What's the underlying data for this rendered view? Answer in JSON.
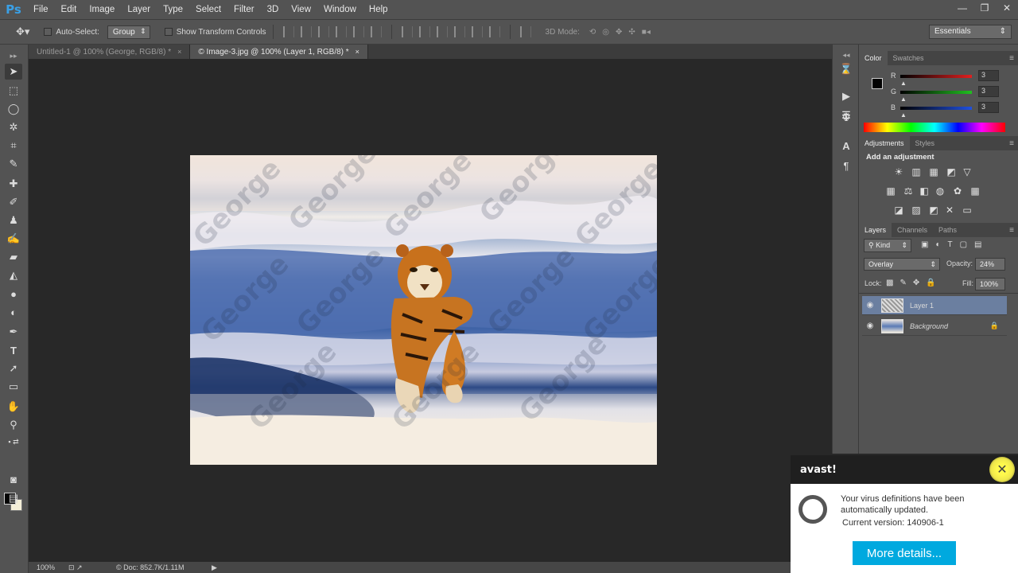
{
  "app": {
    "logo": "Ps"
  },
  "menu": [
    "File",
    "Edit",
    "Image",
    "Layer",
    "Type",
    "Select",
    "Filter",
    "3D",
    "View",
    "Window",
    "Help"
  ],
  "window_controls": [
    "—",
    "❐",
    "✕"
  ],
  "options": {
    "auto_select_label": "Auto-Select:",
    "auto_select_value": "Group",
    "transform_label": "Show Transform Controls",
    "mode_3d_label": "3D Mode:",
    "workspace": "Essentials"
  },
  "tabs": [
    {
      "label": "Untitled-1 @ 100% (George, RGB/8) *",
      "close": "×",
      "active": false
    },
    {
      "label": "© Image-3.jpg @ 100% (Layer 1, RGB/8) *",
      "close": "×",
      "active": true
    }
  ],
  "canvas": {
    "watermark": "George"
  },
  "status": {
    "zoom": "100%",
    "doc": "© Doc: 852.7K/1.11M",
    "arrow": "▶"
  },
  "color_panel": {
    "tabs": [
      "Color",
      "Swatches"
    ],
    "channels": [
      {
        "label": "R",
        "value": "3",
        "color": "#e02020"
      },
      {
        "label": "G",
        "value": "3",
        "color": "#20c020"
      },
      {
        "label": "B",
        "value": "3",
        "color": "#2050e0"
      }
    ]
  },
  "adjustments_panel": {
    "tabs": [
      "Adjustments",
      "Styles"
    ],
    "heading": "Add an adjustment"
  },
  "layers_panel": {
    "tabs": [
      "Layers",
      "Channels",
      "Paths"
    ],
    "kind": "Kind",
    "blend_mode": "Overlay",
    "opacity_label": "Opacity:",
    "opacity_value": "24%",
    "lock_label": "Lock:",
    "fill_label": "Fill:",
    "fill_value": "100%",
    "layers": [
      {
        "name": "Layer 1",
        "selected": true
      },
      {
        "name": "Background",
        "selected": false
      }
    ]
  },
  "avast": {
    "brand": "avast!",
    "message": "Your virus definitions have been automatically updated.",
    "version": "Current version: 140906-1",
    "button": "More details..."
  }
}
